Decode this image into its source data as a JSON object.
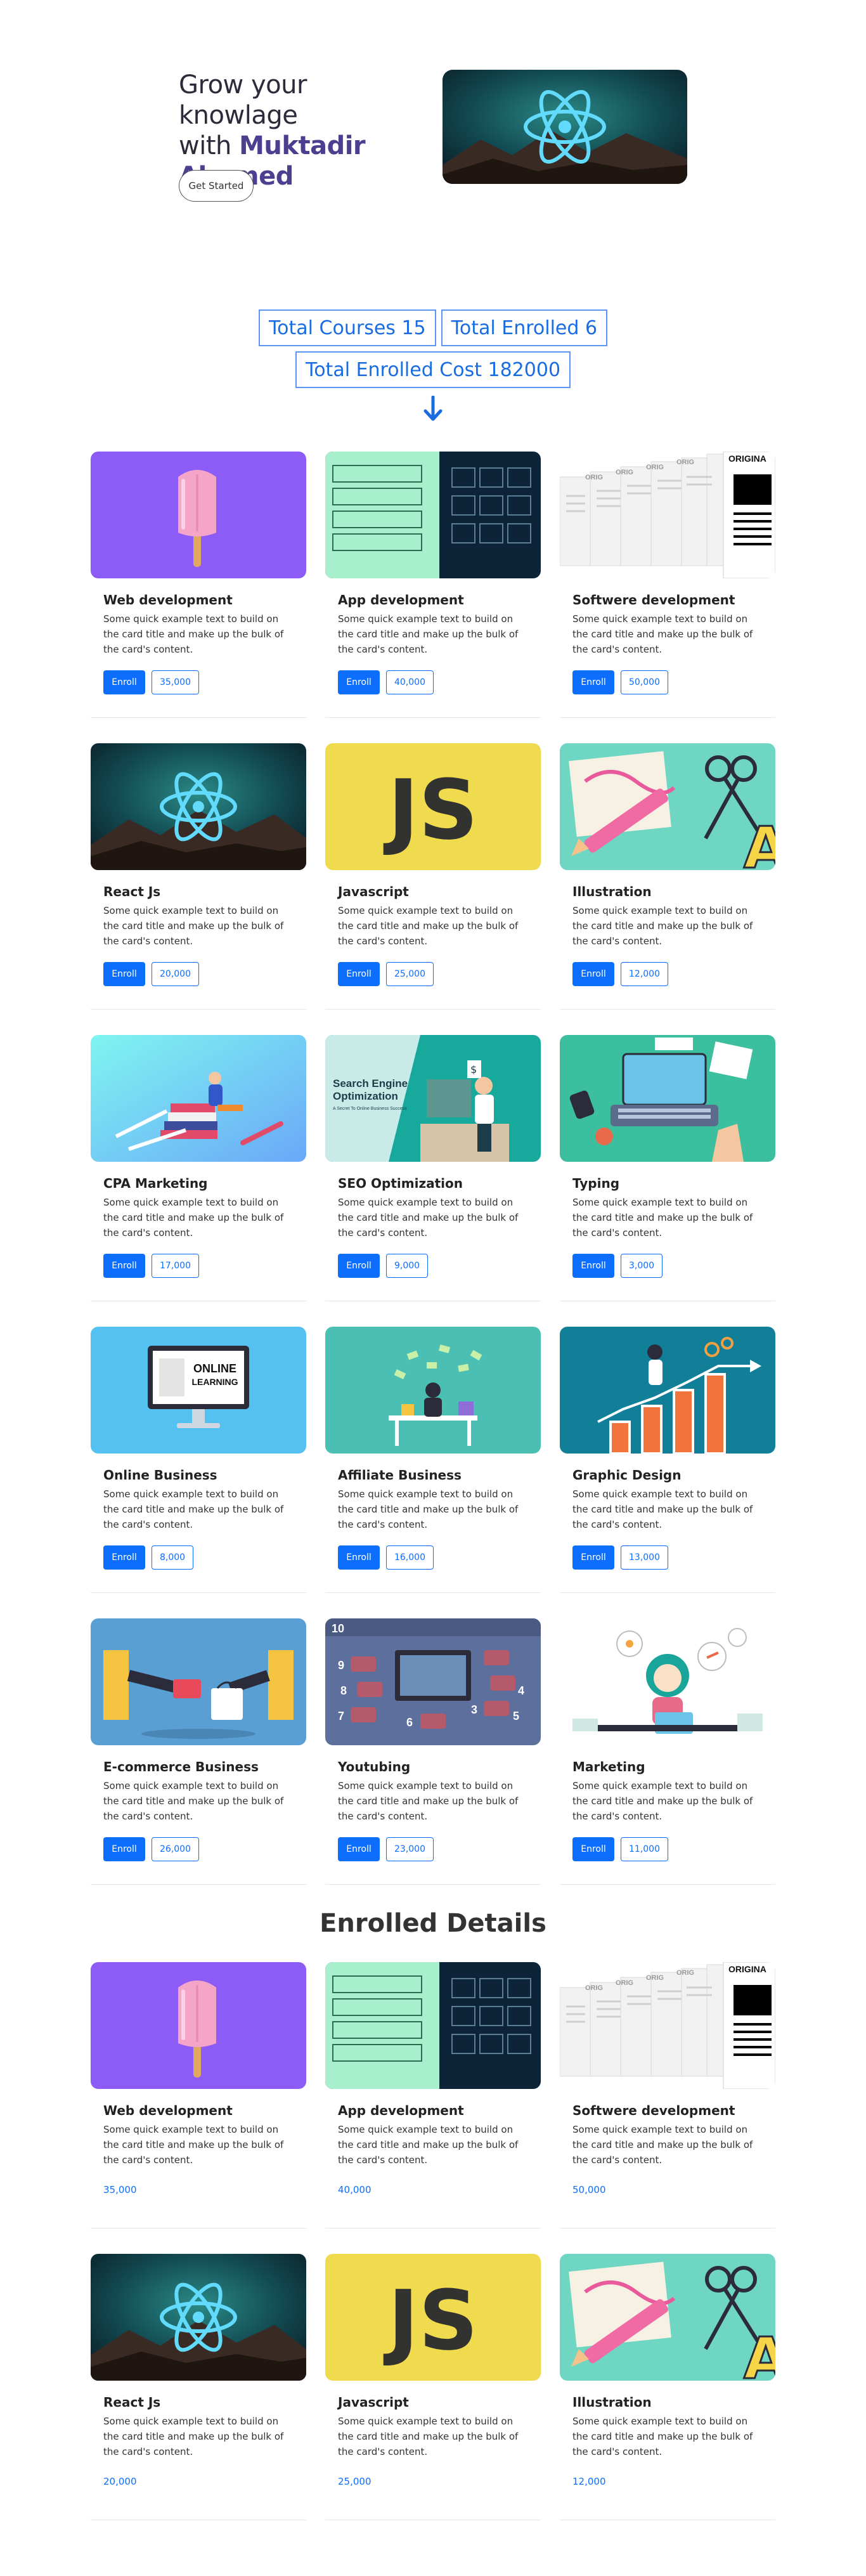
{
  "hero": {
    "title_line1": "Grow your knowlage",
    "title_with": "with",
    "title_name": "Muktadir Ahamed",
    "button_label": "Get Started"
  },
  "stats": {
    "total_courses": "Total Courses 15",
    "total_enrolled": "Total Enrolled 6",
    "total_cost": "Total Enrolled Cost 182000"
  },
  "card_text": "Some quick example text to build on the card title and make up the bulk of the card's content.",
  "enroll_label": "Enroll",
  "courses": [
    {
      "title": "Web development",
      "price": "35,000",
      "icon": "popsicle-illustration"
    },
    {
      "title": "App development",
      "price": "40,000",
      "icon": "app-wireframe-illustration"
    },
    {
      "title": "Softwere development",
      "price": "50,000",
      "icon": "documents-illustration"
    },
    {
      "title": "React Js",
      "price": "20,000",
      "icon": "react-logo-illustration"
    },
    {
      "title": "Javascript",
      "price": "25,000",
      "icon": "js-logo-illustration"
    },
    {
      "title": "Illustration",
      "price": "12,000",
      "icon": "pencil-scissors-illustration"
    },
    {
      "title": "CPA Marketing",
      "price": "17,000",
      "icon": "books-person-illustration"
    },
    {
      "title": "SEO Optimization",
      "price": "9,000",
      "icon": "seo-illustration"
    },
    {
      "title": "Typing",
      "price": "3,000",
      "icon": "laptop-typing-illustration"
    },
    {
      "title": "Online Business",
      "price": "8,000",
      "icon": "monitor-online-learning-illustration"
    },
    {
      "title": "Affiliate Business",
      "price": "16,000",
      "icon": "money-desk-illustration"
    },
    {
      "title": "Graphic Design",
      "price": "13,000",
      "icon": "growth-chart-illustration"
    },
    {
      "title": "E-commerce Business",
      "price": "26,000",
      "icon": "ecommerce-illustration"
    },
    {
      "title": "Youtubing",
      "price": "23,000",
      "icon": "youtube-monitor-illustration"
    },
    {
      "title": "Marketing",
      "price": "11,000",
      "icon": "marketing-woman-illustration"
    }
  ],
  "seo_image": {
    "line1": "Search Engine",
    "line2": "Optimization",
    "line3": "A Secret To Online Business Success"
  },
  "online_image": {
    "line1": "ONLINE",
    "line2": "LEARNING"
  },
  "documents_image": {
    "label": "ORIGINA",
    "label_short": "ORIG"
  },
  "js_image": {
    "label": "JS"
  },
  "enrolled_title": "Enrolled Details",
  "enrolled": [
    {
      "title": "Web development",
      "price": "35,000",
      "icon": "popsicle-illustration"
    },
    {
      "title": "App development",
      "price": "40,000",
      "icon": "app-wireframe-illustration"
    },
    {
      "title": "Softwere development",
      "price": "50,000",
      "icon": "documents-illustration"
    },
    {
      "title": "React Js",
      "price": "20,000",
      "icon": "react-logo-illustration"
    },
    {
      "title": "Javascript",
      "price": "25,000",
      "icon": "js-logo-illustration"
    },
    {
      "title": "Illustration",
      "price": "12,000",
      "icon": "pencil-scissors-illustration"
    }
  ],
  "colors": {
    "primary": "#0d6efd",
    "stat_border": "#5a95f5",
    "name_accent": "#4c3f8f"
  }
}
